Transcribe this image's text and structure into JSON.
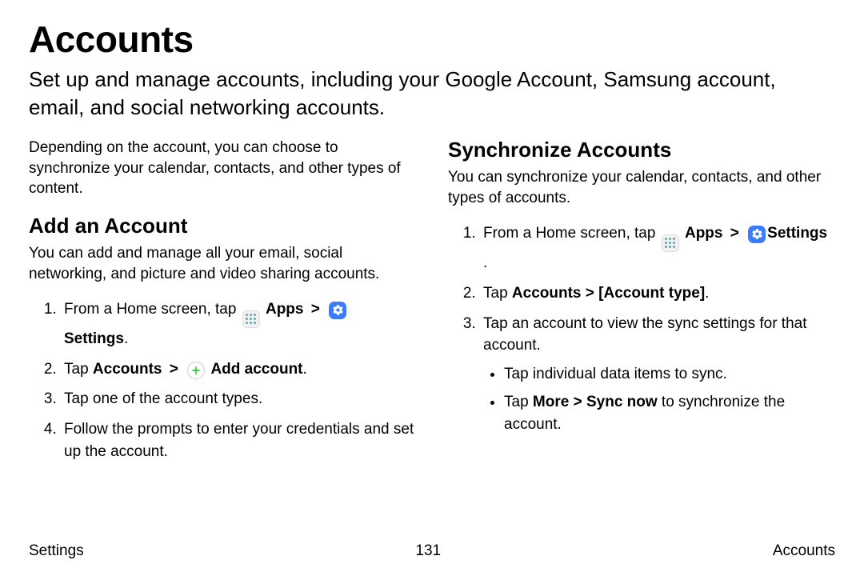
{
  "page_title": "Accounts",
  "intro": "Set up and manage accounts, including your Google Account, Samsung account, email, and social networking accounts.",
  "left": {
    "note": "Depending on the account, you can choose to synchronize your calendar, contacts, and other types of content.",
    "heading": "Add an Account",
    "desc": "You can add and manage all your email, social networking, and picture and video sharing accounts.",
    "step1_pre": "From a Home screen, tap ",
    "apps_label": "Apps",
    "chev": ">",
    "settings_label": "Settings",
    "period": ".",
    "step2_pre": "Tap ",
    "step2_accounts": "Accounts",
    "step2_add": "Add account",
    "step3": "Tap one of the account types.",
    "step4": "Follow the prompts to enter your credentials and set up the account."
  },
  "right": {
    "heading": "Synchronize Accounts",
    "desc": "You can synchronize your calendar, contacts, and other types of accounts.",
    "step1_pre": "From a Home screen, tap ",
    "apps_label": "Apps",
    "chev": ">",
    "settings_label": "Settings",
    "space_period": " .",
    "step2_pre": "Tap ",
    "step2_bold": "Accounts > [Account type]",
    "step2_period": ".",
    "step3": "Tap an account to view the sync settings for that account.",
    "bullet1": "Tap individual data items to sync.",
    "bullet2_pre": "Tap ",
    "bullet2_bold": "More > Sync now",
    "bullet2_post": " to synchronize the account."
  },
  "footer": {
    "left": "Settings",
    "center": "131",
    "right": "Accounts"
  }
}
